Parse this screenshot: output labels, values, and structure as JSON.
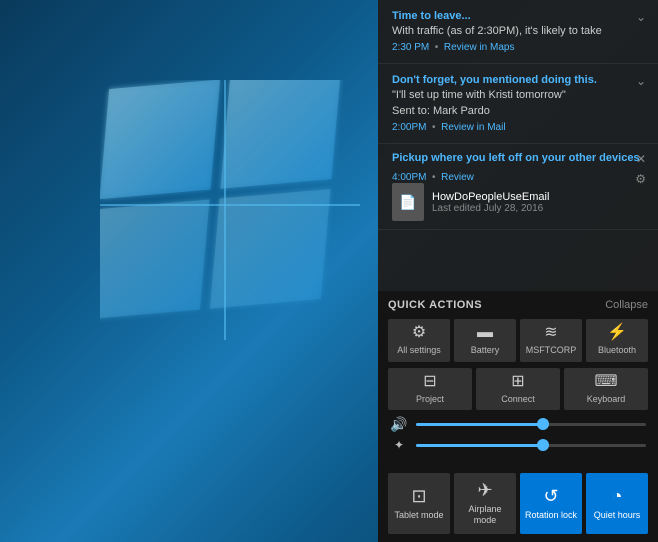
{
  "desktop": {
    "background": "windows10"
  },
  "notifications": [
    {
      "id": "notif-1",
      "title": "Time to leave...",
      "body": "With traffic (as of 2:30PM), it's likely to take",
      "time": "2:30 PM",
      "action": "Review in Maps",
      "has_chevron": true
    },
    {
      "id": "notif-2",
      "title": "Don't forget, you mentioned doing this.",
      "body": "\"I'll set up time with Kristi tomorrow\"",
      "sent_to": "Sent to: Mark Pardo",
      "time": "2:00PM",
      "action": "Review in Mail",
      "has_chevron": true
    },
    {
      "id": "notif-3",
      "title": "Pickup where you left off on your other devices",
      "time": "4:00PM",
      "action": "Review",
      "doc_name": "HowDoPeopleUseEmail",
      "doc_sub": "Last edited July 28, 2016",
      "has_close": true,
      "has_gear": true
    }
  ],
  "quick_actions": {
    "title": "QUICK ACTIONS",
    "collapse_label": "Collapse",
    "row1": [
      {
        "id": "all-settings",
        "icon": "⚙",
        "label": "All settings"
      },
      {
        "id": "battery",
        "icon": "🔋",
        "label": "Battery"
      },
      {
        "id": "msftcorp",
        "icon": "📶",
        "label": "MSFTCORP"
      },
      {
        "id": "bluetooth",
        "icon": "⚡",
        "label": "Bluetooth"
      }
    ],
    "row2": [
      {
        "id": "project",
        "icon": "🖥",
        "label": "Project"
      },
      {
        "id": "connect",
        "icon": "📡",
        "label": "Connect"
      },
      {
        "id": "keyboard",
        "icon": "⌨",
        "label": "Keyboard"
      }
    ]
  },
  "sliders": {
    "volume": {
      "icon": "🔊",
      "fill_percent": 55
    },
    "brightness": {
      "icon": "✦",
      "fill_percent": 55
    }
  },
  "bottom_toggles": [
    {
      "id": "tablet-mode",
      "icon": "⊞",
      "label": "Tablet mode",
      "active": false
    },
    {
      "id": "airplane-mode",
      "icon": "✈",
      "label": "Airplane mode",
      "active": false
    },
    {
      "id": "rotation-lock",
      "icon": "↺",
      "label": "Rotation lock",
      "active": true
    },
    {
      "id": "quiet-hours",
      "icon": "◔",
      "label": "Quiet hours",
      "active": true
    }
  ]
}
